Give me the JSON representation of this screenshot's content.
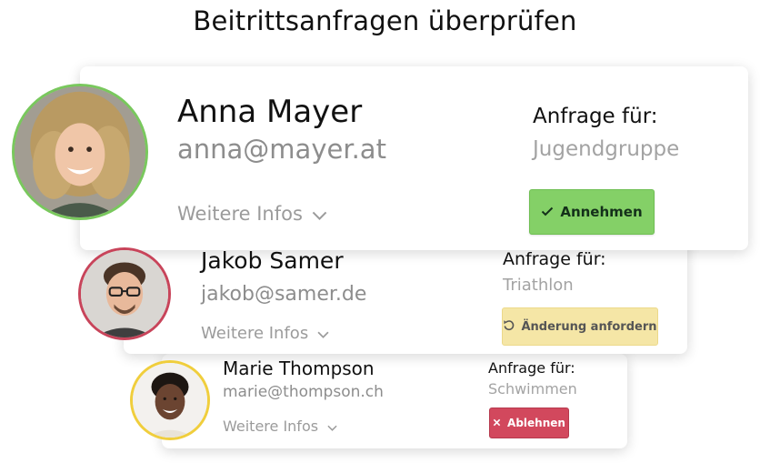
{
  "title": "Beitrittsanfragen überprüfen",
  "colors": {
    "accept": "#84d067",
    "change": "#f5e6a6",
    "reject": "#d2485d",
    "ring_anna": "#79c85d",
    "ring_jakob": "#c8445a",
    "ring_marie": "#f0ce3c"
  },
  "requests": [
    {
      "name": "Anna Mayer",
      "email": "anna@mayer.at",
      "more_label": "Weitere Infos",
      "request_label": "Anfrage für:",
      "group": "Jugendgruppe",
      "action_label": "Annehmen",
      "action_icon": "check-icon"
    },
    {
      "name": "Jakob Samer",
      "email": "jakob@samer.de",
      "more_label": "Weitere Infos",
      "request_label": "Anfrage für:",
      "group": "Triathlon",
      "action_label": "Änderung anfordern",
      "action_icon": "undo-icon"
    },
    {
      "name": "Marie Thompson",
      "email": "marie@thompson.ch",
      "more_label": "Weitere Infos",
      "request_label": "Anfrage für:",
      "group": "Schwimmen",
      "action_label": "Ablehnen",
      "action_icon": "close-icon"
    }
  ]
}
